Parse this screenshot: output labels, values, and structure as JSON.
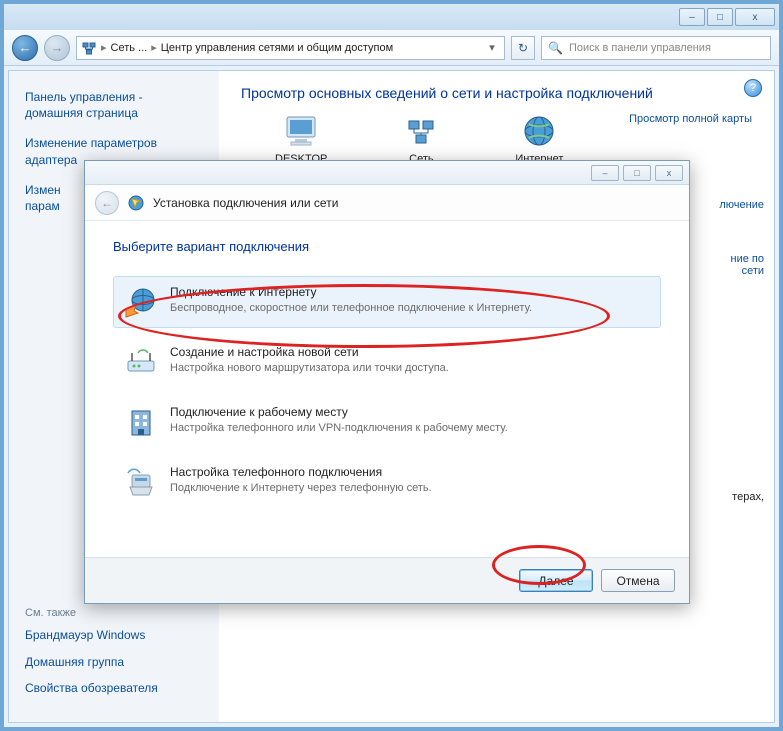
{
  "titlebar": {
    "minimize": "–",
    "maximize": "□",
    "close": "x"
  },
  "nav": {
    "back": "←",
    "forward": "→"
  },
  "breadcrumb": {
    "item1": "Сеть ...",
    "item2": "Центр управления сетями и общим доступом"
  },
  "search": {
    "placeholder": "Поиск в панели управления"
  },
  "sidebar": {
    "link1": "Панель управления - домашняя страница",
    "link2": "Изменение параметров адаптера",
    "link3": "Измен",
    "link3b": "парам",
    "see_also": "См. также",
    "foot1": "Брандмауэр Windows",
    "foot2": "Домашняя группа",
    "foot3": "Свойства обозревателя"
  },
  "main": {
    "heading": "Просмотр основных сведений о сети и настройка подключений",
    "map_link": "Просмотр полной карты",
    "node1": "DESKTOP",
    "node2": "Сеть",
    "node3": "Интернет",
    "partial_right1": "лючение",
    "partial_right2a": "ние по",
    "partial_right2b": "сети",
    "partial_bottom": "терах,"
  },
  "dialog": {
    "titlebar": {
      "minimize": "–",
      "maximize": "□",
      "close": "x"
    },
    "title": "Установка подключения или сети",
    "heading": "Выберите вариант подключения",
    "opt1": {
      "title": "Подключение к Интернету",
      "desc": "Беспроводное, скоростное или телефонное подключение к Интернету."
    },
    "opt2": {
      "title": "Создание и настройка новой сети",
      "desc": "Настройка нового маршрутизатора или точки доступа."
    },
    "opt3": {
      "title": "Подключение к рабочему месту",
      "desc": "Настройка телефонного или VPN-подключения к рабочему месту."
    },
    "opt4": {
      "title": "Настройка телефонного подключения",
      "desc": "Подключение к Интернету через телефонную сеть."
    },
    "next": "Далее",
    "cancel": "Отмена"
  }
}
